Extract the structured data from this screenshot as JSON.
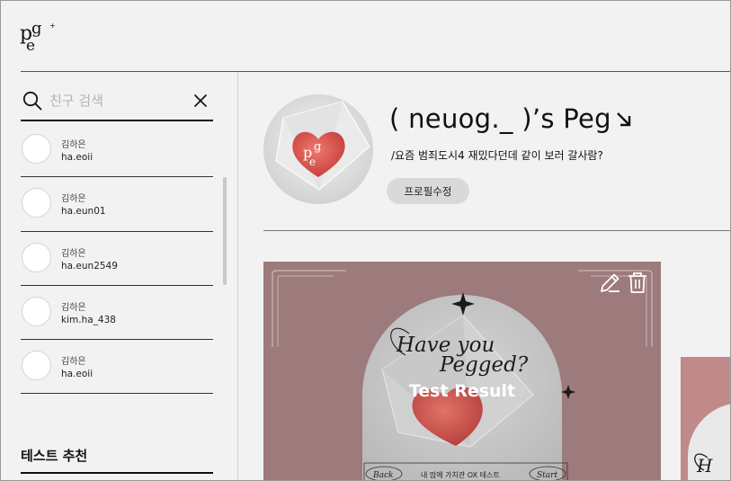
{
  "header": {
    "logo_letters": "peg"
  },
  "search": {
    "placeholder": "친구 검색"
  },
  "friends": [
    {
      "name": "김하은",
      "id": "ha.eoii"
    },
    {
      "name": "김하은",
      "id": "ha.eun01"
    },
    {
      "name": "김하은",
      "id": "ha.eun2549"
    },
    {
      "name": "김하은",
      "id": "kim.ha_438"
    },
    {
      "name": "김하은",
      "id": "ha.eoii"
    }
  ],
  "recommend": {
    "title": "테스트 추천"
  },
  "profile": {
    "title": "( neuog._ )’s Peg",
    "bio": "/요즘 범죄도시4 재밌다던데 같이 보러 갈사람?",
    "edit_label": "프로필수정"
  },
  "cards": [
    {
      "label": "Test Result",
      "artwork_lines": [
        "Have you",
        "Pegged?"
      ],
      "back_label": "Back",
      "start_label": "Start",
      "footer_text": "내 맘에 가치관 OX 테스트"
    }
  ],
  "icons": {
    "search": "search-icon",
    "close": "close-icon",
    "edit": "pen-icon",
    "delete": "trash-icon",
    "arrow": "arrow-down-right-icon"
  },
  "colors": {
    "card_bg": "#9d7a7b",
    "card2_bg": "#c08a8b",
    "heart": "#d9504d"
  }
}
